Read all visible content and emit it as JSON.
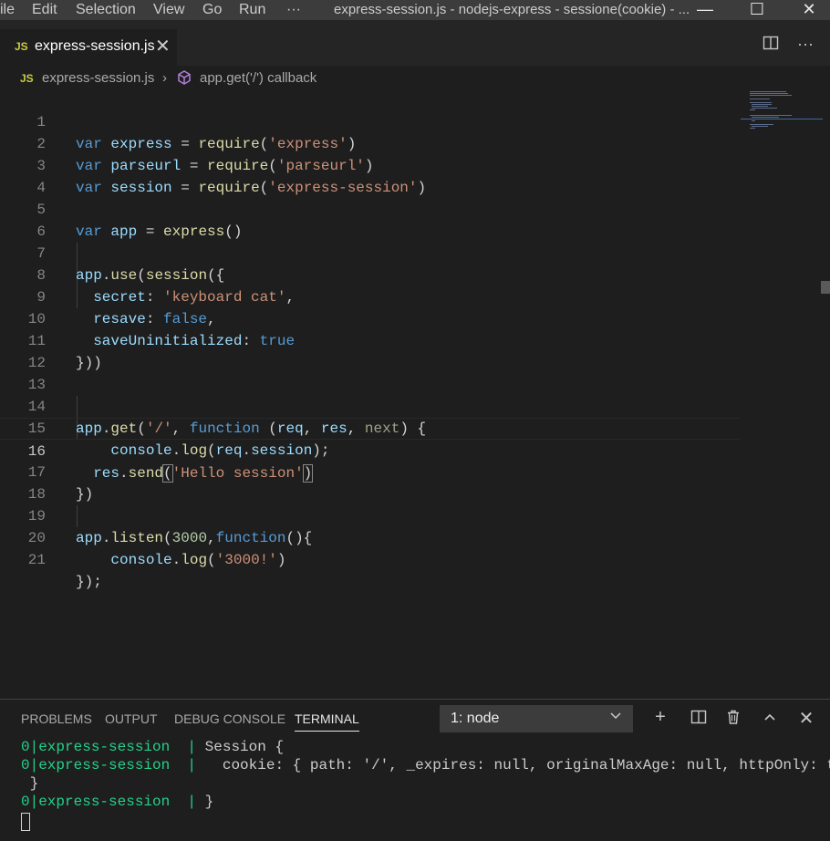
{
  "titlebar": {
    "menu": [
      "ile",
      "Edit",
      "Selection",
      "View",
      "Go",
      "Run",
      "···"
    ],
    "window_title": "express-session.js - nodejs-express - sessione(cookie) - ...",
    "minimize": "—",
    "maximize": "☐",
    "close": "✕"
  },
  "tab": {
    "badge": "JS",
    "label": "express-session.js",
    "close": "✕",
    "split_icon": "split-editor-icon",
    "more": "···"
  },
  "breadcrumb": {
    "badge": "JS",
    "file": "express-session.js",
    "separator": "›",
    "symbol": "app.get('/') callback"
  },
  "editor": {
    "line_numbers": [
      "1",
      "2",
      "3",
      "4",
      "5",
      "6",
      "7",
      "8",
      "9",
      "10",
      "11",
      "12",
      "13",
      "14",
      "15",
      "16",
      "17",
      "18",
      "19",
      "20",
      "21"
    ],
    "tokens": {
      "var": "var",
      "express": "express",
      "parseurl": "parseurl",
      "session": "session",
      "app": "app",
      "eq": " = ",
      "require": "require",
      "s_express": "'express'",
      "s_parseurl": "'parseurl'",
      "s_session": "'express-session'",
      "use": "use",
      "secret": "secret",
      "s_secret": "'keyboard cat'",
      "resave": "resave",
      "false": "false",
      "saveUninitialized": "saveUninitialized",
      "true": "true",
      "get": "get",
      "s_root": "'/'",
      "function": "function",
      "req": "req",
      "res": "res",
      "next": "next",
      "console": "console",
      "log": "log",
      "send": "send",
      "s_hello": "'Hello session'",
      "listen": "listen",
      "n3000": "3000",
      "s_3000": "'3000!'"
    }
  },
  "panel": {
    "tabs": [
      "PROBLEMS",
      "OUTPUT",
      "DEBUG CONSOLE",
      "TERMINAL"
    ],
    "active_tab": "TERMINAL",
    "terminal_select": "1: node",
    "actions": [
      "+",
      "split-terminal-icon",
      "trash-icon",
      "^",
      "✕"
    ],
    "lines": [
      {
        "prefix": "0|express-session  | ",
        "text": "Session {"
      },
      {
        "prefix": "0|express-session  | ",
        "text": "  cookie: { path: '/', _expires: null, originalMaxAge: null, httpOnly: true"
      },
      {
        "prefix": "",
        "text": " }"
      },
      {
        "prefix": "0|express-session  | ",
        "text": "}"
      }
    ]
  },
  "colors": {
    "keyword": "#569cd6",
    "variable": "#9cdcfe",
    "function": "#dcdcaa",
    "string": "#ce9178",
    "number": "#b5cea8",
    "terminal_green": "#23d18b"
  }
}
